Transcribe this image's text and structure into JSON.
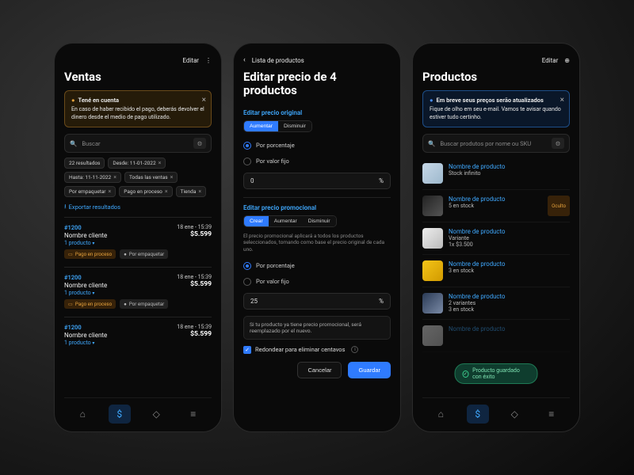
{
  "ventas": {
    "header": {
      "edit": "Editar"
    },
    "title": "Ventas",
    "alert": {
      "title": "Tené en cuenta",
      "body": "En caso de haber recibido el pago, deberás devolver el dinero desde el medio de pago utilizado."
    },
    "search": {
      "placeholder": "Buscar"
    },
    "results_label": "22 resultados",
    "chips": [
      "Desde: 11-01-2022",
      "Hasta: 11-11-2022",
      "Todas las ventas",
      "Por empaquetar",
      "Pago en proceso",
      "Tienda"
    ],
    "export": "Exportar resultados",
    "sales": [
      {
        "id": "#1200",
        "name": "Nombre cliente",
        "date": "18 ene - 15:39",
        "price": "$5.599",
        "sub": "1 producto",
        "badges": [
          "Pago en proceso",
          "Por empaquetar"
        ]
      },
      {
        "id": "#1200",
        "name": "Nombre cliente",
        "date": "18 ene - 15:39",
        "price": "$5.599",
        "sub": "1 producto",
        "badges": [
          "Pago en proceso",
          "Por empaquetar"
        ]
      },
      {
        "id": "#1200",
        "name": "Nombre cliente",
        "date": "18 ene - 15:39",
        "price": "$5.599",
        "sub": "1 producto",
        "badges": []
      }
    ]
  },
  "editar": {
    "back": "Lista de productos",
    "title": "Editar precio de 4 productos",
    "sec1": {
      "label": "Editar precio original",
      "seg": [
        "Aumentar",
        "Disminuir"
      ],
      "r1": "Por porcentaje",
      "r2": "Por valor fijo",
      "value": "0",
      "unit": "%"
    },
    "sec2": {
      "label": "Editar precio promocional",
      "seg": [
        "Crear",
        "Aumentar",
        "Disminuir"
      ],
      "desc": "El precio promocional aplicará a todos los productos seleccionados, tomando como base el precio original de cada uno.",
      "r1": "Por porcentaje",
      "r2": "Por valor fijo",
      "value": "25",
      "unit": "%",
      "note": "Si tu producto ya tiene precio promocional, será reemplazado por el nuevo."
    },
    "round": "Redondear para eliminar centavos",
    "cancel": "Cancelar",
    "save": "Guardar"
  },
  "productos": {
    "header": {
      "edit": "Editar"
    },
    "title": "Productos",
    "alert": {
      "title": "Em breve seus preços serão atualizados",
      "body": "Fique de olho em seu e-mail. Vamos te avisar quando estiver tudo certinho."
    },
    "search": {
      "placeholder": "Buscar produtos por nome ou SKU"
    },
    "items": [
      {
        "name": "Nombre de producto",
        "sub": "Stock infinito",
        "badge": ""
      },
      {
        "name": "Nombre de producto",
        "sub": "5 en stock",
        "badge": "Oculto"
      },
      {
        "name": "Nombre de producto",
        "sub": "Variante",
        "sub2": "1x $3.500"
      },
      {
        "name": "Nombre de producto",
        "sub": "3 en stock"
      },
      {
        "name": "Nombre de producto",
        "sub": "2 variantes",
        "sub2": "3 en stock"
      },
      {
        "name": "Nombre de producto",
        "sub": ""
      }
    ],
    "toast": "Producto guardado con éxito"
  }
}
